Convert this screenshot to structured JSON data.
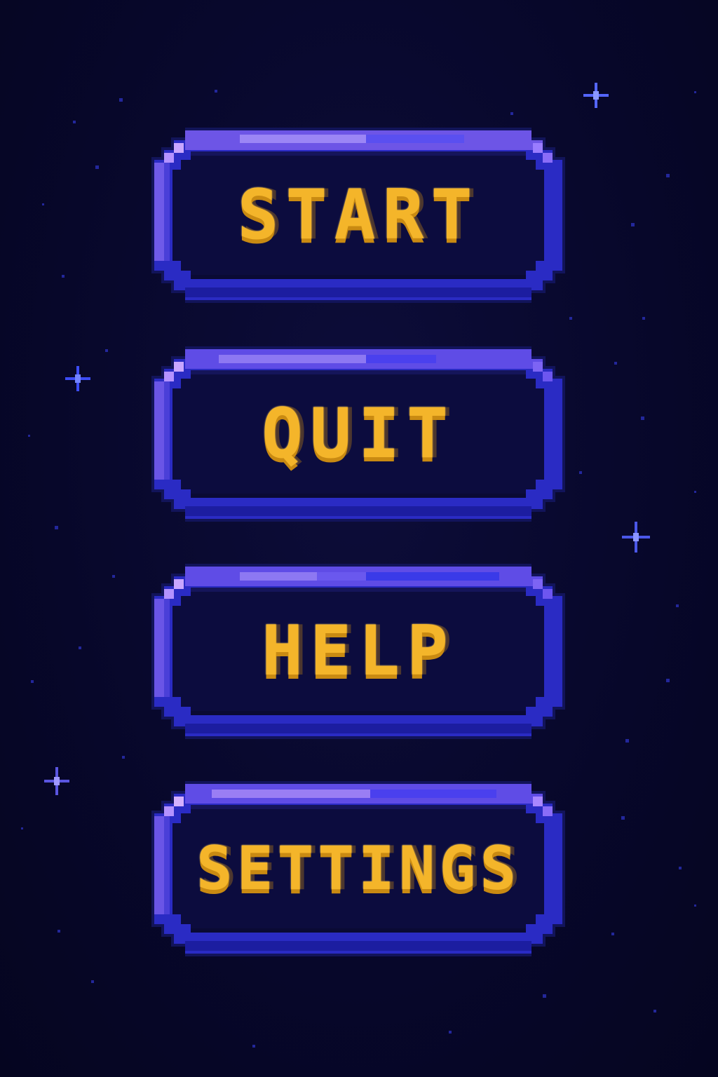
{
  "menu": {
    "buttons": [
      {
        "id": "start",
        "label": "START"
      },
      {
        "id": "quit",
        "label": "QUIT"
      },
      {
        "id": "help",
        "label": "HELP"
      },
      {
        "id": "settings",
        "label": "SETTINGS"
      }
    ]
  },
  "colors": {
    "background": "#07072a",
    "button_fill": "#0c0c3e",
    "button_border_dark": "#1b1c8f",
    "button_border_mid": "#2f2fd0",
    "button_highlight": "#8f6cf0",
    "button_highlight_light": "#c9a6ff",
    "label_color": "#f4b52a",
    "star_color": "#3a48ff"
  }
}
